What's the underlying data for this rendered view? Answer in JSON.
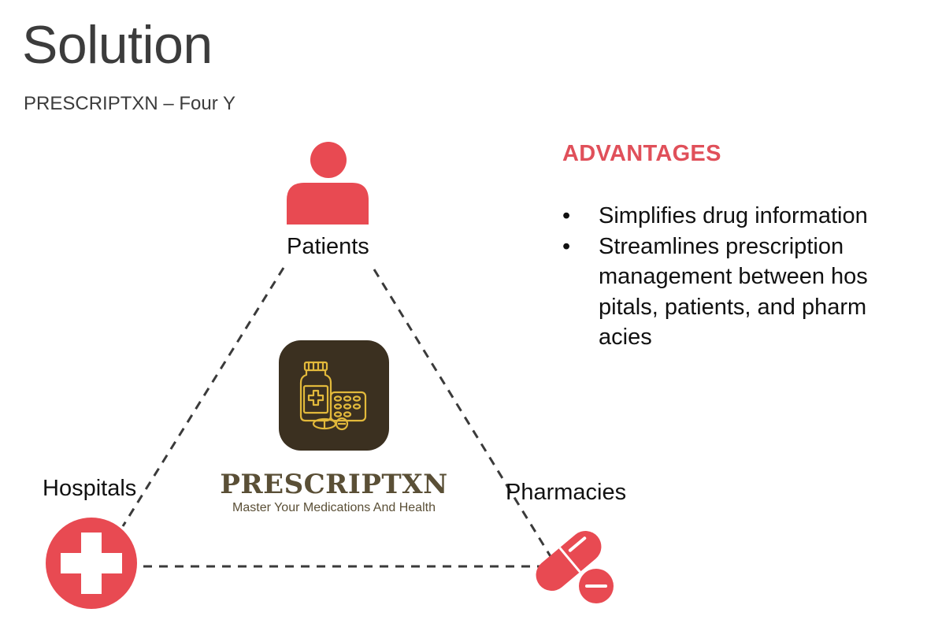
{
  "header": {
    "title": "Solution",
    "subtitle": "PRESCRIPTXN – Four Y"
  },
  "diagram": {
    "nodes": {
      "patients": {
        "label": "Patients",
        "icon": "person-icon"
      },
      "hospitals": {
        "label": "Hospitals",
        "icon": "medical-cross-icon"
      },
      "pharmacies": {
        "label": "Pharmacies",
        "icon": "pill-icon"
      }
    },
    "center_logo": {
      "icon": "medicine-bottle-and-pills-icon",
      "brand_name": "PRESCRIPTXN",
      "tagline": "Master Your Medications And Health"
    }
  },
  "advantages": {
    "heading": "ADVANTAGES",
    "items": [
      {
        "bullet": "•",
        "text": "Simplifies drug information"
      },
      {
        "bullet": "•",
        "text": "Streamlines prescription management between hos pitals, patients, and pharm acies"
      }
    ]
  },
  "colors": {
    "accent_red": "#e84a52",
    "heading_red": "#e0505a",
    "logo_bg": "#3b3020",
    "logo_gold": "#e2b93b",
    "brand_text": "#5a4f36",
    "title_text": "#3c3c3c"
  }
}
